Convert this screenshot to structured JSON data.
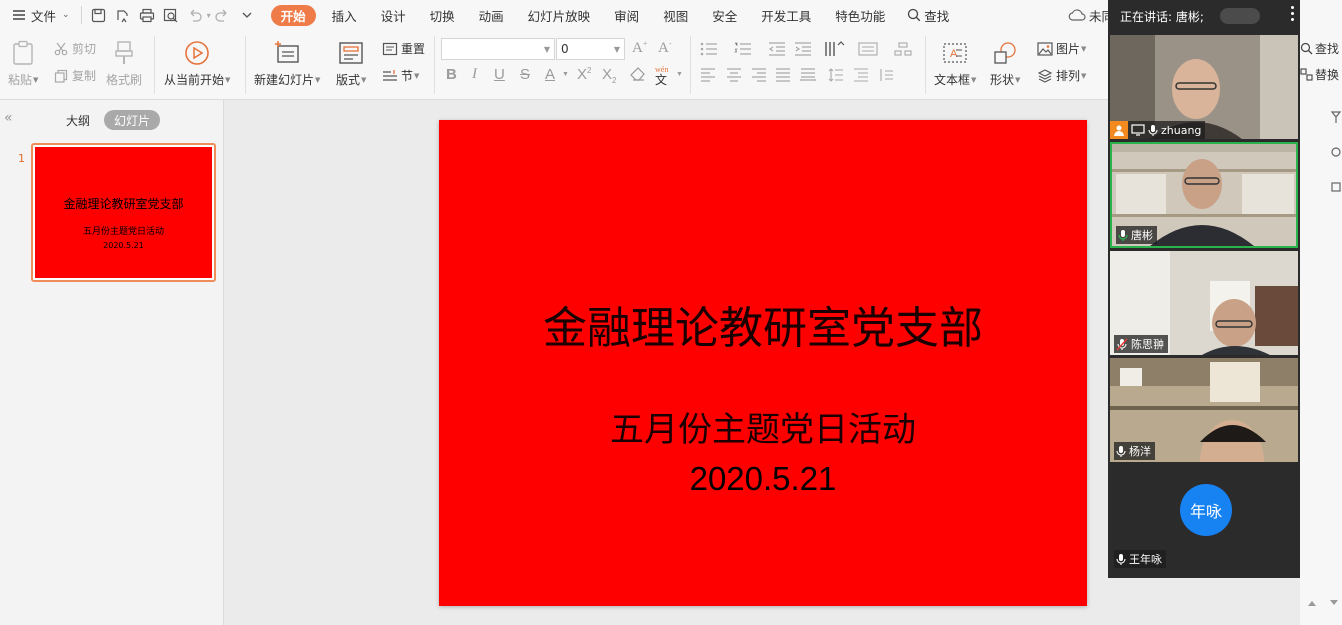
{
  "menubar": {
    "hamburger_label": "文件",
    "tabs": [
      {
        "label": "开始",
        "active": true
      },
      {
        "label": "插入"
      },
      {
        "label": "设计"
      },
      {
        "label": "切换"
      },
      {
        "label": "动画"
      },
      {
        "label": "幻灯片放映"
      },
      {
        "label": "审阅"
      },
      {
        "label": "视图"
      },
      {
        "label": "安全"
      },
      {
        "label": "开发工具"
      },
      {
        "label": "特色功能"
      }
    ],
    "search_label": "查找",
    "sync_label": "未同",
    "accent_color": "#ef7c48"
  },
  "ribbon": {
    "paste": "粘贴",
    "cut": "剪切",
    "copy": "复制",
    "format_painter": "格式刷",
    "play_from_current": "从当前开始",
    "new_slide": "新建幻灯片",
    "layout": "版式",
    "reset": "重置",
    "section": "节",
    "font_name": "",
    "font_size": "0",
    "text_box": "文本框",
    "shape": "形状",
    "picture": "图片",
    "arrange": "排列",
    "find": "查找",
    "replace": "替换"
  },
  "left_panel": {
    "outline_tab": "大纲",
    "slides_tab": "幻灯片",
    "slide_number": "1",
    "thumb_title": "金融理论教研室党支部",
    "thumb_subtitle": "五月份主题党日活动",
    "thumb_date": "2020.5.21"
  },
  "slide": {
    "title": "金融理论教研室党支部",
    "subtitle": "五月份主题党日活动",
    "date": "2020.5.21",
    "background_color": "#ff0000"
  },
  "meeting": {
    "header": "正在讲话: 唐彬;",
    "participants": [
      {
        "name": "zhuang",
        "host": true,
        "muted": false,
        "speaking": false
      },
      {
        "name": "唐彬",
        "host": false,
        "muted": false,
        "speaking": true
      },
      {
        "name": "陈思翀",
        "host": false,
        "muted": true,
        "speaking": false
      },
      {
        "name": "杨洋",
        "host": false,
        "muted": false,
        "speaking": false
      },
      {
        "name": "王年咏",
        "host": false,
        "muted": false,
        "speaking": false,
        "avatar_text": "年咏"
      }
    ],
    "speaking_color": "#2bb34b",
    "avatar_color": "#1782f2"
  }
}
